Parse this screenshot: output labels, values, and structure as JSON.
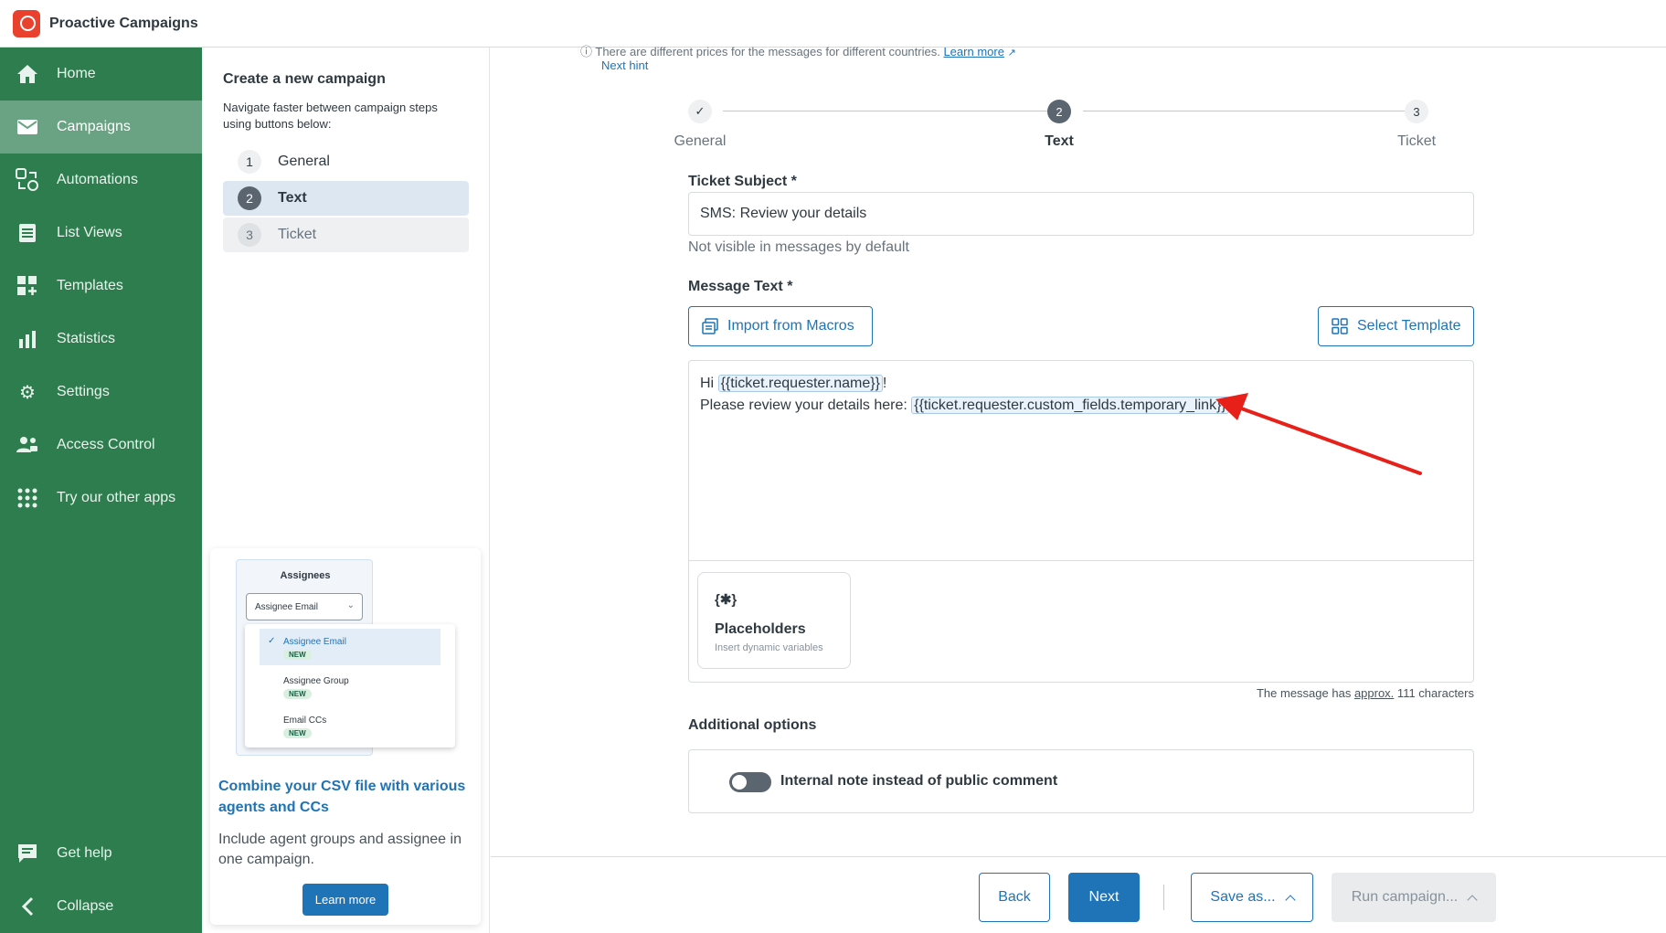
{
  "app": {
    "title": "Proactive Campaigns"
  },
  "sidebar": {
    "items": [
      {
        "label": "Home",
        "icon": "home-icon"
      },
      {
        "label": "Campaigns",
        "icon": "envelope-icon"
      },
      {
        "label": "Automations",
        "icon": "automations-icon"
      },
      {
        "label": "List Views",
        "icon": "list-views-icon"
      },
      {
        "label": "Templates",
        "icon": "templates-icon"
      },
      {
        "label": "Statistics",
        "icon": "bar-chart-icon"
      },
      {
        "label": "Settings",
        "icon": "gear-icon"
      },
      {
        "label": "Access Control",
        "icon": "users-icon"
      },
      {
        "label": "Try our other apps",
        "icon": "grid-dots-icon"
      }
    ],
    "bottom": [
      {
        "label": "Get help",
        "icon": "chat-icon"
      },
      {
        "label": "Collapse",
        "icon": "chevron-left-icon"
      }
    ],
    "active": "Campaigns",
    "colors": {
      "bg": "#2e7d4f",
      "active": "#6aa383"
    }
  },
  "steps_panel": {
    "title": "Create a new campaign",
    "subtitle": "Navigate faster between campaign steps using buttons below:",
    "steps": [
      {
        "num": "1",
        "label": "General"
      },
      {
        "num": "2",
        "label": "Text"
      },
      {
        "num": "3",
        "label": "Ticket"
      }
    ]
  },
  "promo": {
    "card_title": "Assignees",
    "select_value": "Assignee Email",
    "options": [
      {
        "label": "Assignee Email",
        "badge": "NEW"
      },
      {
        "label": "Assignee Group",
        "badge": "NEW"
      },
      {
        "label": "Email CCs",
        "badge": "NEW"
      }
    ],
    "heading": "Combine your CSV file with various agents and CCs",
    "body": "Include agent groups and assignee in one campaign.",
    "button": "Learn more"
  },
  "hint": {
    "text": "There are different prices for the messages for different countries.",
    "link": "Learn more",
    "next": "Next hint"
  },
  "stepper": {
    "steps": [
      {
        "num": "",
        "label": "General",
        "state": "done"
      },
      {
        "num": "2",
        "label": "Text",
        "state": "current"
      },
      {
        "num": "3",
        "label": "Ticket",
        "state": "upcoming"
      }
    ]
  },
  "form": {
    "subject_label": "Ticket Subject *",
    "subject_value": "SMS: Review your details",
    "subject_hint": "Not visible in messages by default",
    "message_label": "Message Text *",
    "import_macros": "Import from Macros",
    "select_template": "Select Template",
    "message": {
      "line1_prefix": "Hi ",
      "line1_placeholder": "{{ticket.requester.name}}",
      "line1_suffix": "!",
      "line2_prefix": "Please review your details here: ",
      "line2_placeholder": "{{ticket.requester.custom_fields.temporary_link}}"
    },
    "placeholders_card": {
      "title": "Placeholders",
      "subtitle": "Insert dynamic variables",
      "icon": "{✱}"
    },
    "char_count": {
      "prefix": "The message has ",
      "approx": "approx.",
      "suffix": " 111 characters"
    },
    "additional_title": "Additional options",
    "toggle_label": "Internal note instead of public comment",
    "toggle_on": false
  },
  "footer": {
    "back": "Back",
    "next": "Next",
    "save": "Save as...",
    "run": "Run campaign..."
  },
  "colors": {
    "primary": "#1f73b7",
    "annotation_arrow": "#e8201a"
  }
}
